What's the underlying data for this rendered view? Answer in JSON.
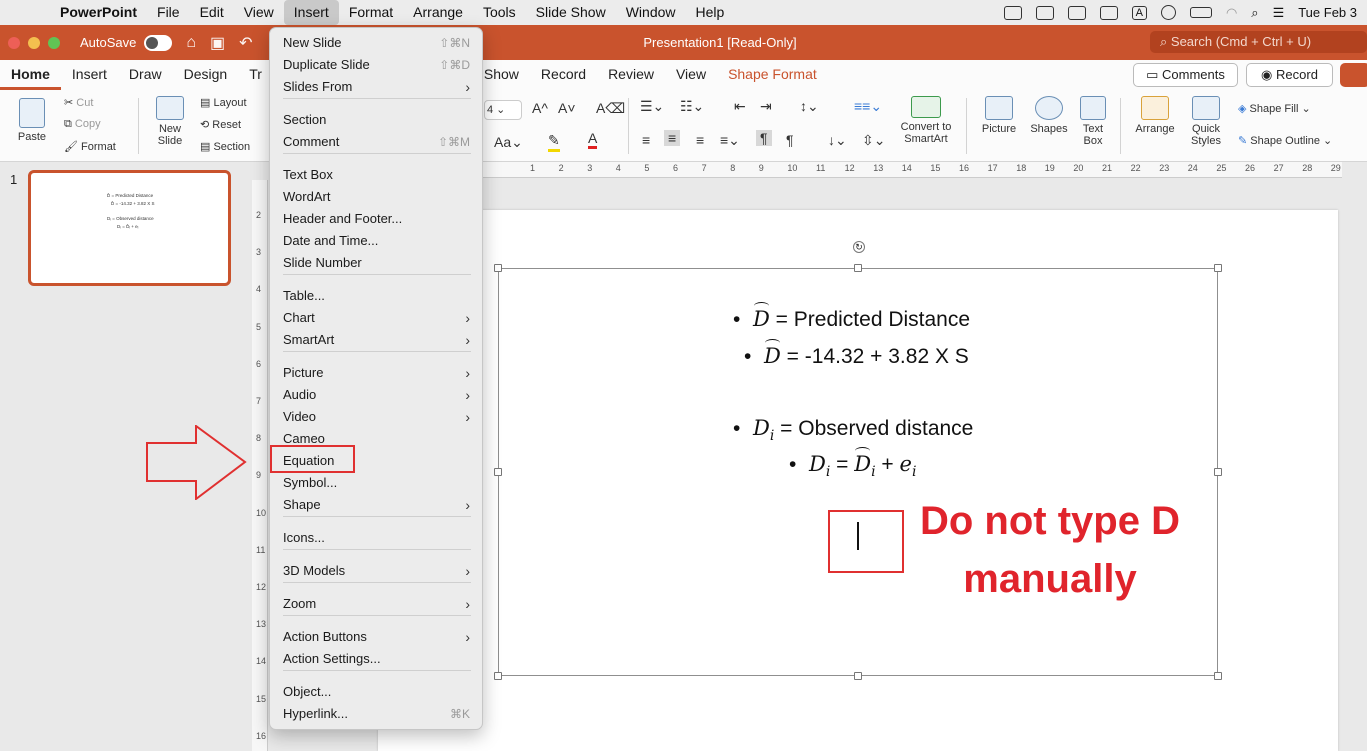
{
  "menubar": {
    "app": "PowerPoint",
    "items": [
      "File",
      "Edit",
      "View",
      "Insert",
      "Format",
      "Arrange",
      "Tools",
      "Slide Show",
      "Window",
      "Help"
    ],
    "active": "Insert",
    "clock": "Tue Feb 3"
  },
  "titlebar": {
    "autosave": "AutoSave",
    "doc_title": "Presentation1 [Read-Only]",
    "search_placeholder": "Search (Cmd + Ctrl + U)"
  },
  "tabs": [
    "Home",
    "Insert",
    "Draw",
    "Design",
    "Tr",
    "Show",
    "Record",
    "Review",
    "View",
    "Shape Format"
  ],
  "tabs_active": "Home",
  "actions": {
    "comments": "Comments",
    "record": "Record"
  },
  "ribbon": {
    "paste": "Paste",
    "cut": "Cut",
    "copy": "Copy",
    "format": "Format",
    "new_slide": [
      "New",
      "Slide"
    ],
    "layout": "Layout",
    "reset": "Reset",
    "section": "Section",
    "font_size": "4",
    "convert_smartart": [
      "Convert to",
      "SmartArt"
    ],
    "picture": "Picture",
    "shapes": "Shapes",
    "text_box": [
      "Text",
      "Box"
    ],
    "arrange": "Arrange",
    "quick_styles": [
      "Quick",
      "Styles"
    ],
    "shape_fill": "Shape Fill",
    "shape_outline": "Shape Outline"
  },
  "thumbnail": {
    "number": "1",
    "lines": [
      "D̂ = Predicted Distance",
      "D̂ = -14.32 + 3.82 X S",
      "Dᵢ = Observed distance",
      "Dᵢ = D̂ᵢ + eᵢ"
    ]
  },
  "ruler": {
    "h": [
      "1",
      "2",
      "3",
      "4",
      "5",
      "6",
      "7",
      "8",
      "9",
      "10",
      "11",
      "12",
      "13",
      "14",
      "15",
      "16",
      "17",
      "18",
      "19",
      "20",
      "21",
      "22",
      "23",
      "24",
      "25",
      "26",
      "27",
      "28",
      "29"
    ],
    "v": [
      "2",
      "3",
      "4",
      "5",
      "6",
      "7",
      "8",
      "9",
      "10",
      "11",
      "12",
      "13",
      "14",
      "15",
      "16"
    ]
  },
  "slide": {
    "line1": {
      "sym": "D",
      "text": " = Predicted Distance"
    },
    "line2": {
      "sym": "D",
      "text": " = -14.32 + 3.82 X S"
    },
    "line3": {
      "sym": "D",
      "sub": "i",
      "text": " = Observed distance"
    },
    "line4": {
      "lhs": "D",
      "lhs_sub": "i",
      "eq": " = ",
      "rhs": "D",
      "rhs_sub": "i",
      "plus": " + ",
      "e": "e",
      "e_sub": "i"
    },
    "warning": [
      "Do not type D",
      "manually"
    ]
  },
  "insert_menu": {
    "items": [
      {
        "label": "New Slide",
        "shortcut": "⇧⌘N"
      },
      {
        "label": "Duplicate Slide",
        "shortcut": "⇧⌘D"
      },
      {
        "label": "Slides From",
        "submenu": true
      },
      {
        "label": "Section"
      },
      {
        "label": "Comment",
        "shortcut": "⇧⌘M"
      },
      {
        "label": "Text Box"
      },
      {
        "label": "WordArt"
      },
      {
        "label": "Header and Footer..."
      },
      {
        "label": "Date and Time..."
      },
      {
        "label": "Slide Number"
      },
      {
        "label": "Table..."
      },
      {
        "label": "Chart",
        "submenu": true
      },
      {
        "label": "SmartArt",
        "submenu": true
      },
      {
        "label": "Picture",
        "submenu": true
      },
      {
        "label": "Audio",
        "submenu": true
      },
      {
        "label": "Video",
        "submenu": true
      },
      {
        "label": "Cameo"
      },
      {
        "label": "Equation",
        "highlight": true
      },
      {
        "label": "Symbol..."
      },
      {
        "label": "Shape",
        "submenu": true
      },
      {
        "label": "Icons..."
      },
      {
        "label": "3D Models",
        "submenu": true
      },
      {
        "label": "Zoom",
        "submenu": true
      },
      {
        "label": "Action Buttons",
        "submenu": true
      },
      {
        "label": "Action Settings..."
      },
      {
        "label": "Object..."
      },
      {
        "label": "Hyperlink...",
        "shortcut": "⌘K"
      }
    ]
  },
  "colors": {
    "brand": "#c9532d",
    "annotation": "#e0242c"
  }
}
